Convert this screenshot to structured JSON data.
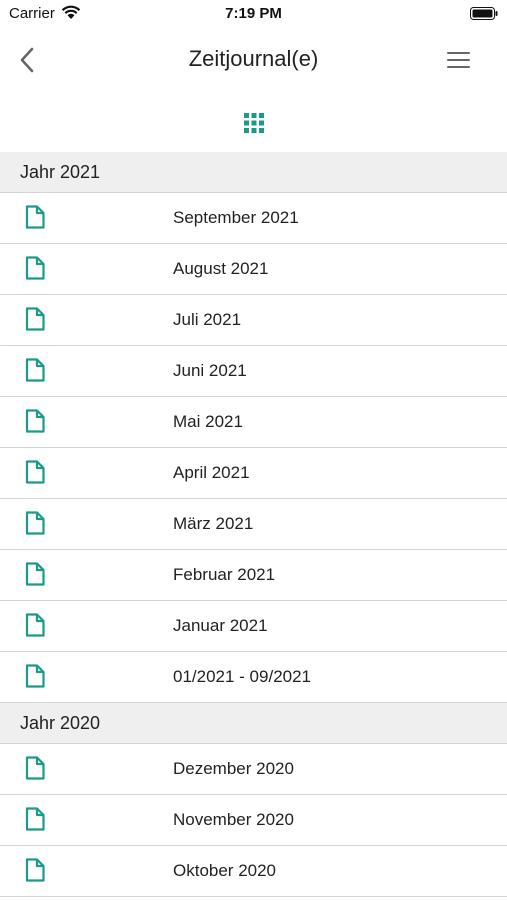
{
  "status": {
    "carrier": "Carrier",
    "time": "7:19 PM"
  },
  "nav": {
    "title": "Zeitjournal(e)"
  },
  "colors": {
    "accent": "#1a9a87"
  },
  "icons": {
    "back": "chevron-left-icon",
    "menu": "hamburger-menu-icon",
    "view_toggle": "grid-icon",
    "row": "document-icon"
  },
  "sections": [
    {
      "header": "Jahr 2021",
      "items": [
        "September 2021",
        "August 2021",
        "Juli 2021",
        "Juni 2021",
        "Mai 2021",
        "April 2021",
        "März 2021",
        "Februar 2021",
        "Januar 2021",
        "01/2021 - 09/2021"
      ]
    },
    {
      "header": "Jahr 2020",
      "items": [
        "Dezember 2020",
        "November 2020",
        "Oktober 2020"
      ]
    }
  ]
}
